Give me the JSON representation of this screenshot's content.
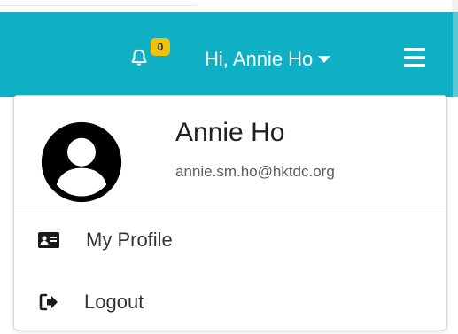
{
  "header": {
    "notification_count": "0",
    "greeting": "Hi, Annie Ho",
    "icons": {
      "bell": "bell-icon",
      "caret": "caret-down-icon",
      "menu": "hamburger-menu-icon"
    },
    "colors": {
      "bar": "#0fb0c3",
      "badge": "#f0c20c",
      "text": "#ffffff"
    }
  },
  "dropdown": {
    "user": {
      "name": "Annie Ho",
      "email": "annie.sm.ho@hktdc.org",
      "avatar_icon": "user-avatar-icon"
    },
    "items": [
      {
        "label": "My Profile",
        "icon": "id-card-icon"
      },
      {
        "label": "Logout",
        "icon": "sign-out-icon"
      }
    ]
  }
}
